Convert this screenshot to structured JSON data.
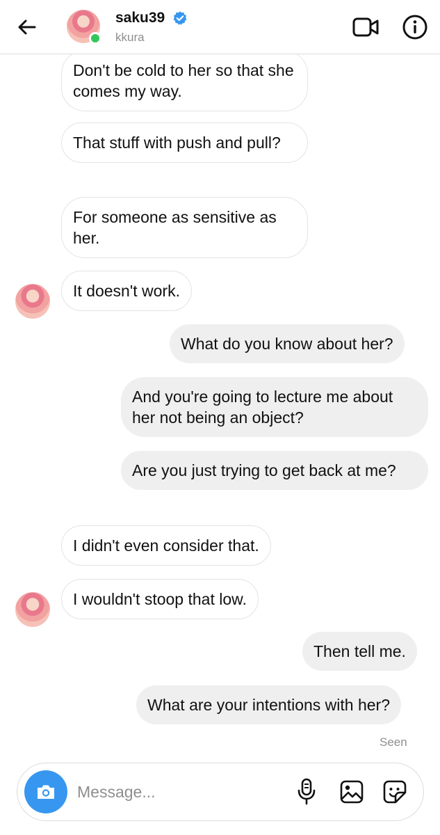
{
  "header": {
    "username": "saku39",
    "subname": "kkura",
    "verified": true,
    "online": true
  },
  "messages": [
    {
      "side": "incoming",
      "text": "Don't be cold to her so that she comes my way."
    },
    {
      "side": "incoming",
      "text": "That stuff with push and pull?"
    },
    {
      "side": "incoming",
      "text": "For someone as sensitive as her."
    },
    {
      "side": "incoming",
      "text": "It doesn't work.",
      "avatar": true
    },
    {
      "side": "outgoing",
      "text": "What do you know about her?"
    },
    {
      "side": "outgoing",
      "text": "And you're going to lecture me about her not being an object?"
    },
    {
      "side": "outgoing",
      "text": "Are you just trying to get back at me?"
    },
    {
      "side": "incoming",
      "text": "I didn't even consider that."
    },
    {
      "side": "incoming",
      "text": "I wouldn't stoop that low.",
      "avatar": true
    },
    {
      "side": "outgoing",
      "text": "Then tell me."
    },
    {
      "side": "outgoing",
      "text": "What are your intentions with her?"
    }
  ],
  "seen_label": "Seen",
  "composer": {
    "placeholder": "Message..."
  },
  "colors": {
    "accent": "#3797f0",
    "online": "#33c759",
    "outgoing_bubble": "#efefef",
    "muted_text": "#8e8e8e"
  },
  "icons": {
    "back": "arrow-left-icon",
    "verified": "verified-badge-icon",
    "video": "video-call-icon",
    "info": "info-icon",
    "camera": "camera-icon",
    "mic": "microphone-icon",
    "gallery": "gallery-icon",
    "sticker": "sticker-icon"
  }
}
